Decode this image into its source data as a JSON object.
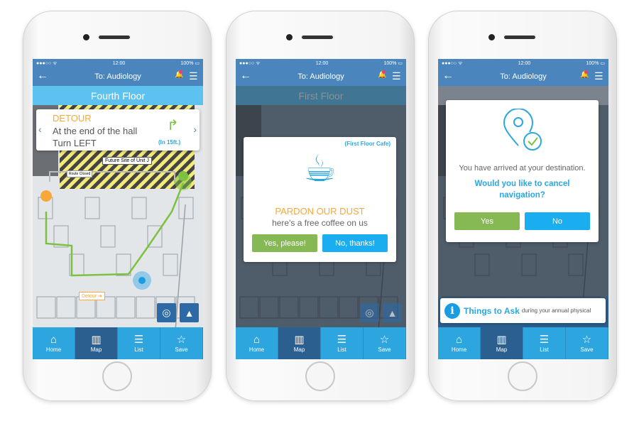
{
  "colors": {
    "header": "#4a86bd",
    "floor_bar": "#5ec2f1",
    "tab_bar": "#2da6df",
    "tab_active": "#2b5f8f",
    "detour_orange": "#f7a83a",
    "route_green": "#7dc142",
    "button_green": "#86b853",
    "button_blue": "#1aaef0",
    "link_blue": "#2aa7e0"
  },
  "phones": [
    {
      "status": {
        "signal": "●●●○○ ᯤ",
        "time": "12:00",
        "battery": "100% ▭"
      },
      "header": {
        "back_icon": "arrow-left",
        "title": "To: Audiology",
        "bell_icon": "bell",
        "menu_icon": "hamburger"
      },
      "floor": "Fourth Floor",
      "tabs": [
        {
          "label": "Home",
          "icon": "home"
        },
        {
          "label": "Map",
          "icon": "map",
          "active": true
        },
        {
          "label": "List",
          "icon": "list"
        },
        {
          "label": "Save",
          "icon": "star"
        }
      ]
    },
    {
      "status": {
        "signal": "●●●○○ ᯤ",
        "time": "12:00",
        "battery": "100% ▭"
      },
      "header": {
        "back_icon": "arrow-left",
        "title": "To: Audiology",
        "bell_icon": "bell",
        "menu_icon": "hamburger"
      },
      "floor": "First Floor",
      "tabs": [
        {
          "label": "Home",
          "icon": "home"
        },
        {
          "label": "Map",
          "icon": "map",
          "active": true
        },
        {
          "label": "List",
          "icon": "list"
        },
        {
          "label": "Save",
          "icon": "star"
        }
      ]
    },
    {
      "status": {
        "signal": "●●●○○ ᯤ",
        "time": "12:00",
        "battery": "100% ▭"
      },
      "header": {
        "back_icon": "arrow-left",
        "title": "To: Audiology",
        "bell_icon": "bell",
        "menu_icon": "hamburger"
      },
      "floor": "",
      "tabs": [
        {
          "label": "Home",
          "icon": "home"
        },
        {
          "label": "Map",
          "icon": "map",
          "active": true
        },
        {
          "label": "List",
          "icon": "list"
        },
        {
          "label": "Save",
          "icon": "star"
        }
      ]
    }
  ],
  "detour": {
    "label": "DETOUR",
    "line1": "At the end of the hall",
    "line2": "Turn LEFT",
    "distance": "(In 15ft.)"
  },
  "map1": {
    "construction_label": "Future Site of Unit J",
    "route_closed": "Route Closed",
    "detour_tag": "Detour ➜"
  },
  "coffee": {
    "location": "(First Floor Cafe)",
    "title": "PARDON OUR DUST",
    "subtitle": "here's a free coffee on us",
    "yes": "Yes, please!",
    "no": "No, thanks!"
  },
  "arrived": {
    "message": "You have arrived at your destination.",
    "question": "Would you like to cancel navigation?",
    "yes": "Yes",
    "no": "No"
  },
  "banner": {
    "title": "Things to Ask",
    "subtitle": "during your annual physical"
  }
}
